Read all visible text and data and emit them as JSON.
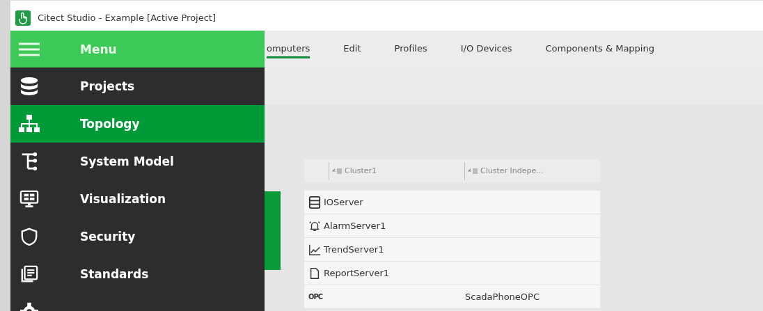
{
  "window": {
    "title": "Citect Studio - Example [Active Project]"
  },
  "tabs": [
    {
      "label": "omputers",
      "selected": true
    },
    {
      "label": "Edit",
      "selected": false
    },
    {
      "label": "Profiles",
      "selected": false
    },
    {
      "label": "I/O Devices",
      "selected": false
    },
    {
      "label": "Components & Mapping",
      "selected": false
    }
  ],
  "menu": {
    "header": "Menu",
    "items": [
      {
        "label": "Projects",
        "kind": "database",
        "selected": false
      },
      {
        "label": "Topology",
        "kind": "topology",
        "selected": true
      },
      {
        "label": "System Model",
        "kind": "tree",
        "selected": false
      },
      {
        "label": "Visualization",
        "kind": "monitor",
        "selected": false
      },
      {
        "label": "Security",
        "kind": "shield",
        "selected": false
      },
      {
        "label": "Standards",
        "kind": "documents",
        "selected": false
      },
      {
        "kind": "gear",
        "selected": false
      }
    ]
  },
  "grid": {
    "columns": [
      "Cluster1",
      "Cluster Indepe..."
    ],
    "rows": [
      {
        "kind": "server",
        "name": "IOServer"
      },
      {
        "kind": "alarm",
        "name": "AlarmServer1"
      },
      {
        "kind": "trend",
        "name": "TrendServer1"
      },
      {
        "kind": "report",
        "name": "ReportServer1"
      },
      {
        "kind": "opc",
        "icon_text": "OPC",
        "column_2": "ScadaPhoneOPC"
      }
    ]
  }
}
